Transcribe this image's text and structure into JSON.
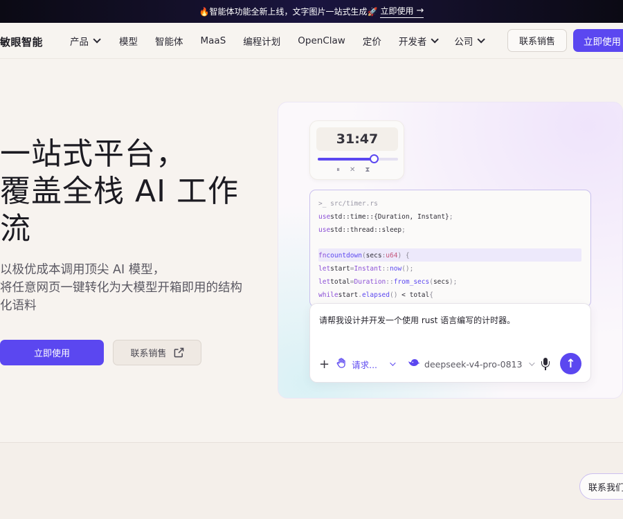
{
  "announcement": {
    "text": "🔥智能体功能全新上线，文字图片一站式生成🚀",
    "cta": "立即使用",
    "cta_arrow": "→"
  },
  "nav": {
    "logo": "敏眼智能",
    "items": [
      {
        "label": "产品",
        "dropdown": true
      },
      {
        "label": "模型",
        "dropdown": false
      },
      {
        "label": "智能体",
        "dropdown": false
      },
      {
        "label": "MaaS",
        "dropdown": false
      },
      {
        "label": "编程计划",
        "dropdown": false
      },
      {
        "label": "OpenClaw",
        "dropdown": false
      },
      {
        "label": "定价",
        "dropdown": false
      },
      {
        "label": "开发者",
        "dropdown": true
      },
      {
        "label": "公司",
        "dropdown": true
      }
    ],
    "contact_sales": "联系销售",
    "start_now": "立即使用"
  },
  "hero": {
    "title_lines": [
      "一站式平台，",
      "覆盖全栈 AI 工作",
      "流"
    ],
    "subtitle_lines": [
      "以极优成本调用顶尖 AI 模型，",
      "将任意网页一键转化为大模型开箱即用的结构",
      "化语料"
    ],
    "primary_button": "立即使用",
    "secondary_button": "联系销售"
  },
  "demo": {
    "timer": {
      "display": "31:47",
      "progress": 0.7,
      "controls": [
        "⏸",
        "✕",
        "⧗"
      ]
    },
    "code": {
      "path": ">_ src/timer.rs",
      "lines": [
        "usestd::time::{Duration, Instant};",
        "usestd::thread::sleep;",
        "",
        "fncountdown(secs:u64) {",
        "letstart=Instant::now();",
        "lettotal=Duration::from_secs(secs);",
        "whilestart.elapsed() < total{"
      ]
    },
    "prompt": {
      "text": "请帮我设计并开发一个使用 rust 语言编写的计时器。",
      "plus": "+",
      "mode_label": "请求...",
      "model_label": "deepseek-v4-pro-0813",
      "send": "↑"
    }
  },
  "floating": {
    "contact": "联系我们"
  },
  "colors": {
    "accent": "#5b47f0",
    "background": "#f7f3ef",
    "announce_bg": "#0b0a14"
  }
}
